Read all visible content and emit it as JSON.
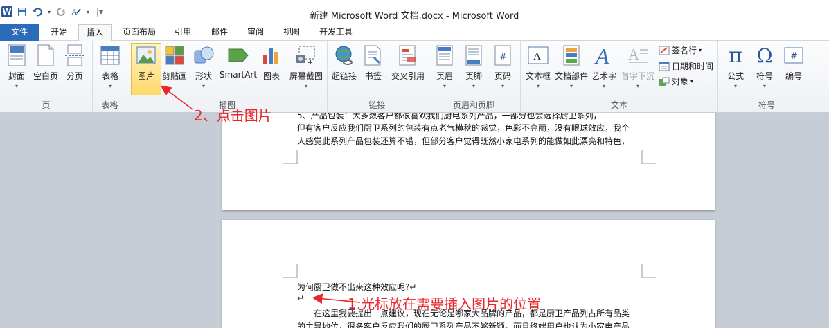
{
  "window": {
    "title": "新建 Microsoft Word 文档.docx  -  Microsoft Word",
    "app_icon_letter": "W"
  },
  "quick_access": {
    "save_icon": "save-icon",
    "undo_icon": "undo-icon",
    "redo_icon": "redo-icon",
    "format_icon": "format-painter-icon"
  },
  "tabs": [
    "文件",
    "开始",
    "插入",
    "页面布局",
    "引用",
    "邮件",
    "审阅",
    "视图",
    "开发工具"
  ],
  "active_tab": "插入",
  "ribbon": {
    "pages": {
      "label": "页",
      "buttons": [
        "封面",
        "空白页",
        "分页"
      ]
    },
    "tables": {
      "label": "表格",
      "buttons": [
        "表格"
      ]
    },
    "illustrations": {
      "label": "插图",
      "buttons": [
        "图片",
        "剪贴画",
        "形状",
        "SmartArt",
        "图表",
        "屏幕截图"
      ]
    },
    "links": {
      "label": "链接",
      "buttons": [
        "超链接",
        "书签",
        "交叉引用"
      ]
    },
    "header_footer": {
      "label": "页眉和页脚",
      "buttons": [
        "页眉",
        "页脚",
        "页码"
      ]
    },
    "text": {
      "label": "文本",
      "buttons": [
        "文本框",
        "文档部件",
        "艺术字",
        "首字下沉"
      ],
      "small": [
        "签名行",
        "日期和时间",
        "对象"
      ]
    },
    "symbols": {
      "label": "符号",
      "buttons": [
        "公式",
        "符号",
        "编号"
      ],
      "glyphs": [
        "π",
        "Ω",
        "#"
      ]
    }
  },
  "document": {
    "page1_lines": [
      "5、产品包装：大多数客户都很喜欢我们厨电系列产品，一部分也会选择厨卫系列，",
      "但有客户反应我们厨卫系列的包装有点老气横秋的感觉，色彩不亮丽，没有眼球效应，我个",
      "人感觉此系列产品包装还算不错，但部分客户觉得既然小家电系列的能做如此漂亮和特色，"
    ],
    "page2_lines": [
      "为何厨卫做不出来这种效应呢?↵",
      "在这里我要提出一点建议，现在无论是哪家大品牌的产品，都是厨卫产品列占所有品类",
      "的主导地位，很多客户反应我们的厨卫系列产品不够新颖。而且终端用户也认为小家电产品"
    ],
    "cursor_mark": "↵"
  },
  "annotations": {
    "step1": "1.光标放在需要插入图片的位置",
    "step2": "2、点击图片",
    "color": "#e8262c"
  }
}
